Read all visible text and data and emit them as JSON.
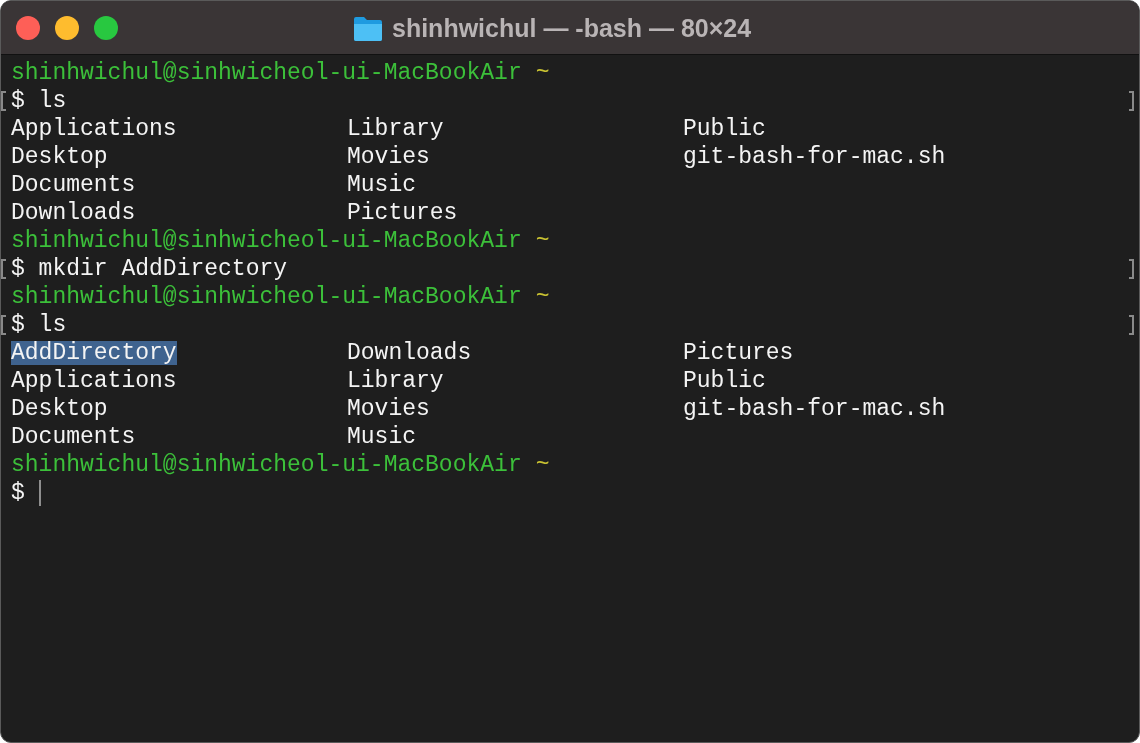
{
  "window": {
    "title": "shinhwichul — -bash — 80×24"
  },
  "lines": [
    {
      "kind": "prompt",
      "user_host": "shinhwichul@sinhwicheol-ui-MacBookAir",
      "dir": "~"
    },
    {
      "kind": "command",
      "text": "$ ls",
      "marked": true
    },
    {
      "kind": "listing",
      "rows": [
        [
          {
            "text": "Applications",
            "selected": false
          },
          {
            "text": "Library",
            "selected": false
          },
          {
            "text": "Public",
            "selected": false
          }
        ],
        [
          {
            "text": "Desktop",
            "selected": false
          },
          {
            "text": "Movies",
            "selected": false
          },
          {
            "text": "git-bash-for-mac.sh",
            "selected": false
          }
        ],
        [
          {
            "text": "Documents",
            "selected": false
          },
          {
            "text": "Music",
            "selected": false
          }
        ],
        [
          {
            "text": "Downloads",
            "selected": false
          },
          {
            "text": "Pictures",
            "selected": false
          }
        ]
      ]
    },
    {
      "kind": "prompt",
      "user_host": "shinhwichul@sinhwicheol-ui-MacBookAir",
      "dir": "~"
    },
    {
      "kind": "command",
      "text": "$ mkdir AddDirectory",
      "marked": true
    },
    {
      "kind": "prompt",
      "user_host": "shinhwichul@sinhwicheol-ui-MacBookAir",
      "dir": "~"
    },
    {
      "kind": "command",
      "text": "$ ls",
      "marked": true
    },
    {
      "kind": "listing",
      "rows": [
        [
          {
            "text": "AddDirectory",
            "selected": true
          },
          {
            "text": "Downloads",
            "selected": false
          },
          {
            "text": "Pictures",
            "selected": false
          }
        ],
        [
          {
            "text": "Applications",
            "selected": false
          },
          {
            "text": "Library",
            "selected": false
          },
          {
            "text": "Public",
            "selected": false
          }
        ],
        [
          {
            "text": "Desktop",
            "selected": false
          },
          {
            "text": "Movies",
            "selected": false
          },
          {
            "text": "git-bash-for-mac.sh",
            "selected": false
          }
        ],
        [
          {
            "text": "Documents",
            "selected": false
          },
          {
            "text": "Music",
            "selected": false
          }
        ]
      ]
    },
    {
      "kind": "prompt",
      "user_host": "shinhwichul@sinhwicheol-ui-MacBookAir",
      "dir": "~"
    },
    {
      "kind": "input",
      "text": "$",
      "cursor": true
    }
  ]
}
